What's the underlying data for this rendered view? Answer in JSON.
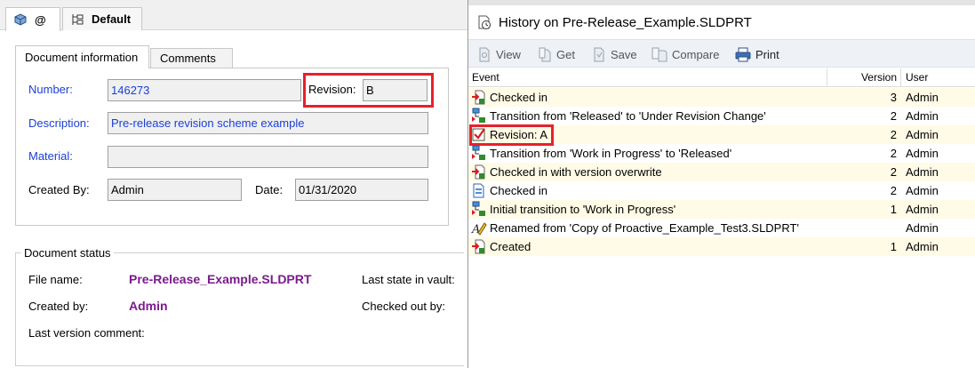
{
  "left": {
    "top_tabs": [
      {
        "label": "@",
        "icon": "part-config-icon"
      },
      {
        "label": "Default",
        "icon": "config-tree-icon"
      }
    ],
    "doc_tabs": [
      "Document information",
      "Comments"
    ],
    "fields": {
      "number_label": "Number:",
      "number_value": "146273",
      "revision_label": "Revision:",
      "revision_value": "B",
      "description_label": "Description:",
      "description_value": "Pre-release revision scheme example",
      "material_label": "Material:",
      "material_value": "",
      "created_by_label": "Created By:",
      "created_by_value": "Admin",
      "date_label": "Date:",
      "date_value": "01/31/2020"
    },
    "status": {
      "legend": "Document status",
      "file_name_label": "File name:",
      "file_name_value": "Pre-Release_Example.SLDPRT",
      "created_by_label": "Created by:",
      "created_by_value": "Admin",
      "last_comment_label": "Last version comment:",
      "last_state_label": "Last state in vault:",
      "checked_out_label": "Checked out by:"
    }
  },
  "history": {
    "title": "History on Pre-Release_Example.SLDPRT",
    "toolbar": [
      "View",
      "Get",
      "Save",
      "Compare",
      "Print"
    ],
    "columns": [
      "Event",
      "Version",
      "User"
    ],
    "rows": [
      {
        "icon": "checkin-icon",
        "event": "Checked in",
        "version": "3",
        "user": "Admin"
      },
      {
        "icon": "workflow-transition-icon",
        "event": "Transition from 'Released' to 'Under Revision Change'",
        "version": "2",
        "user": "Admin"
      },
      {
        "icon": "revision-checkmark-icon",
        "event": "Revision: A",
        "version": "2",
        "user": "Admin"
      },
      {
        "icon": "workflow-transition-icon",
        "event": "Transition from 'Work in Progress' to 'Released'",
        "version": "2",
        "user": "Admin"
      },
      {
        "icon": "checkin-icon",
        "event": "Checked in with version overwrite",
        "version": "2",
        "user": "Admin"
      },
      {
        "icon": "document-checkin-icon",
        "event": "Checked in",
        "version": "2",
        "user": "Admin"
      },
      {
        "icon": "workflow-transition-icon",
        "event": "Initial transition to 'Work in Progress'",
        "version": "1",
        "user": "Admin"
      },
      {
        "icon": "rename-pencil-icon",
        "event": "Renamed from 'Copy of Proactive_Example_Test3.SLDPRT'",
        "version": "",
        "user": "Admin"
      },
      {
        "icon": "created-icon",
        "event": "Created",
        "version": "1",
        "user": "Admin"
      }
    ]
  },
  "colors": {
    "link_blue": "#1a3fd6",
    "value_purple": "#7b1a8e",
    "highlight_red": "#e8202a",
    "row_alt": "#fffbe6"
  }
}
